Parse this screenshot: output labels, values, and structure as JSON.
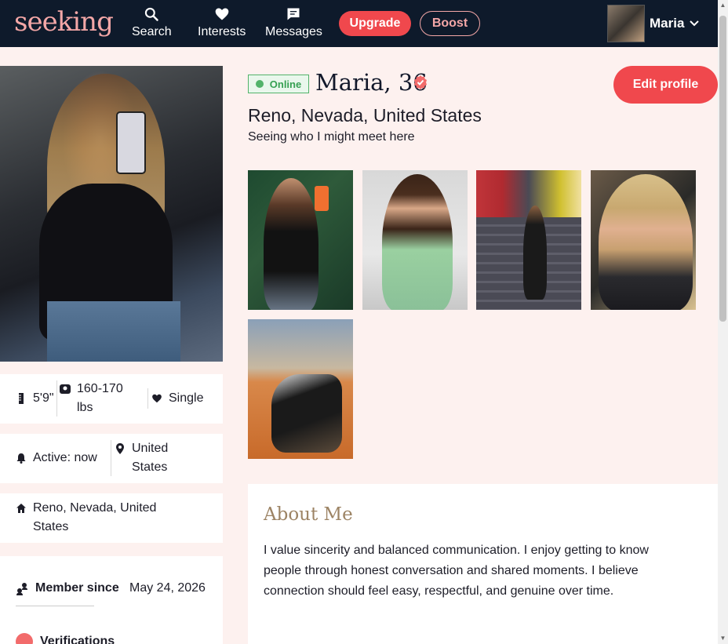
{
  "nav": {
    "logo": "seeking",
    "search_label": "Search",
    "interests_label": "Interests",
    "messages_label": "Messages",
    "upgrade_label": "Upgrade",
    "boost_label": "Boost",
    "user_name": "Maria"
  },
  "profile": {
    "status": "Online",
    "name_age": "Maria, 36",
    "edit_label": "Edit profile",
    "location": "Reno, Nevada, United States",
    "headline": "Seeing who I might meet here"
  },
  "stats": {
    "height": "5'9\"",
    "weight": "160-170 lbs",
    "relationship": "Single",
    "active": "Active: now",
    "country": "United States",
    "home": "Reno, Nevada, United States",
    "member_since_label": "Member since",
    "member_since_value": "May 24, 2026",
    "verifications_label": "Verifications"
  },
  "about": {
    "title": "About Me",
    "text": "I value sincerity and balanced communication. I enjoy getting to know people through honest conversation and shared moments. I believe connection should feel easy, respectful, and genuine over time."
  },
  "colors": {
    "nav_bg": "#0e1a2b",
    "accent": "#f0484d",
    "logo": "#f4a7a7",
    "page_bg": "#fdf1ef",
    "online": "#52b36a",
    "about_title": "#9d8465"
  }
}
